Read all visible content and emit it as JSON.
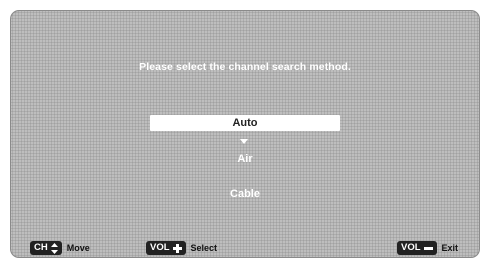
{
  "screen": {
    "prompt": "Please select the channel search method."
  },
  "options": [
    {
      "label": "Auto",
      "selected": true
    },
    {
      "label": "Air",
      "selected": false
    },
    {
      "label": "Cable",
      "selected": false
    }
  ],
  "footer": {
    "move": {
      "key": "CH",
      "icon": "up-down-arrows-icon",
      "label": "Move"
    },
    "select": {
      "key": "VOL",
      "icon": "plus-icon",
      "label": "Select"
    },
    "exit": {
      "key": "VOL",
      "icon": "minus-icon",
      "label": "Exit"
    }
  },
  "colors": {
    "background": "#b9b9b9",
    "text": "#ffffff",
    "selected_bg": "#ffffff",
    "key_bg": "#222222"
  }
}
